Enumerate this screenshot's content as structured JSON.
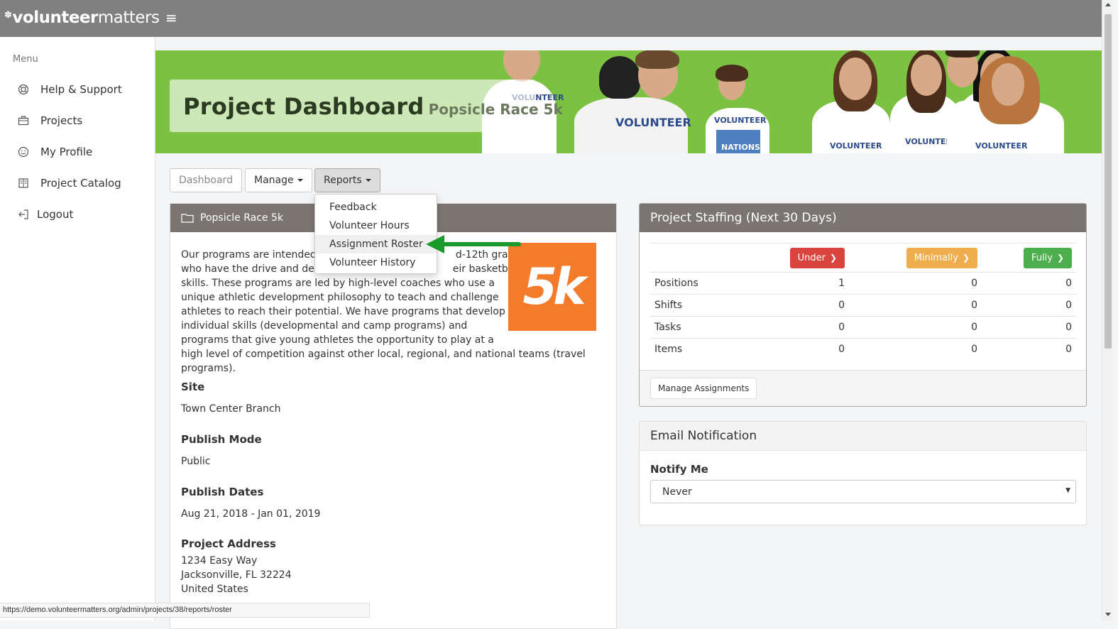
{
  "brand": {
    "logo_bold": "volunteer",
    "logo_light": "matters"
  },
  "sidebar": {
    "title": "Menu",
    "items": [
      {
        "label": "Help & Support",
        "icon": "lifebuoy-icon"
      },
      {
        "label": "Projects",
        "icon": "briefcase-icon"
      },
      {
        "label": "My Profile",
        "icon": "smiley-icon"
      },
      {
        "label": "Project Catalog",
        "icon": "book-icon"
      },
      {
        "label": "Logout",
        "icon": "logout-icon"
      }
    ]
  },
  "hero": {
    "title": "Project Dashboard",
    "subtitle": "Popsicle Race 5k",
    "shirt_text": "VOLUNTEER",
    "box_text": "NATIONS"
  },
  "toolbar": {
    "dashboard": "Dashboard",
    "manage": "Manage",
    "reports": "Reports"
  },
  "reports_menu": {
    "items": [
      "Feedback",
      "Volunteer Hours",
      "Assignment Roster",
      "Volunteer History"
    ],
    "highlighted": "Assignment Roster"
  },
  "project": {
    "name": "Popsicle Race 5k",
    "description": {
      "line1": "Our programs are intended",
      "line1_tail": "d-12th grade",
      "line2": "who have the drive and de",
      "line2_tail": "eir basketball",
      "line3": "skills. These programs are led by high-level coaches who use a",
      "line4": "unique athletic development philosophy to teach and challenge",
      "line5": "athletes to reach their potential. We have programs that develop",
      "line6": "individual skills (developmental and camp programs) and",
      "line7": "programs that give young athletes the opportunity to play at a",
      "line8": "high level of competition against other local, regional, and national teams (travel",
      "line9": "programs)."
    },
    "logo_text": "5k",
    "site_label": "Site",
    "site_value": "Town Center Branch",
    "publish_mode_label": "Publish Mode",
    "publish_mode_value": "Public",
    "publish_dates_label": "Publish Dates",
    "publish_dates_value": "Aug 21, 2018 - Jan 01, 2019",
    "address_label": "Project Address",
    "address_line1": "1234 Easy Way",
    "address_line2": "Jacksonville, FL 32224",
    "address_line3": "United States"
  },
  "staffing": {
    "title": "Project Staffing (Next 30 Days)",
    "columns": [
      {
        "label": "Under",
        "color": "#d9443f"
      },
      {
        "label": "Minimally",
        "color": "#f0ad4e"
      },
      {
        "label": "Fully",
        "color": "#4cae4c"
      }
    ],
    "rows": [
      {
        "label": "Positions",
        "under": "1",
        "minimally": "0",
        "fully": "0"
      },
      {
        "label": "Shifts",
        "under": "0",
        "minimally": "0",
        "fully": "0"
      },
      {
        "label": "Tasks",
        "under": "0",
        "minimally": "0",
        "fully": "0"
      },
      {
        "label": "Items",
        "under": "0",
        "minimally": "0",
        "fully": "0"
      }
    ],
    "manage_button": "Manage Assignments"
  },
  "email": {
    "title": "Email Notification",
    "notify_label": "Notify Me",
    "notify_value": "Never"
  },
  "status_url": "https://demo.volunteermatters.org/admin/projects/38/reports/roster",
  "colors": {
    "hero_green": "#7cc242",
    "panel_header": "#7a7570",
    "arrow_green": "#1a9a2a",
    "logo_orange": "#f47b2a"
  }
}
